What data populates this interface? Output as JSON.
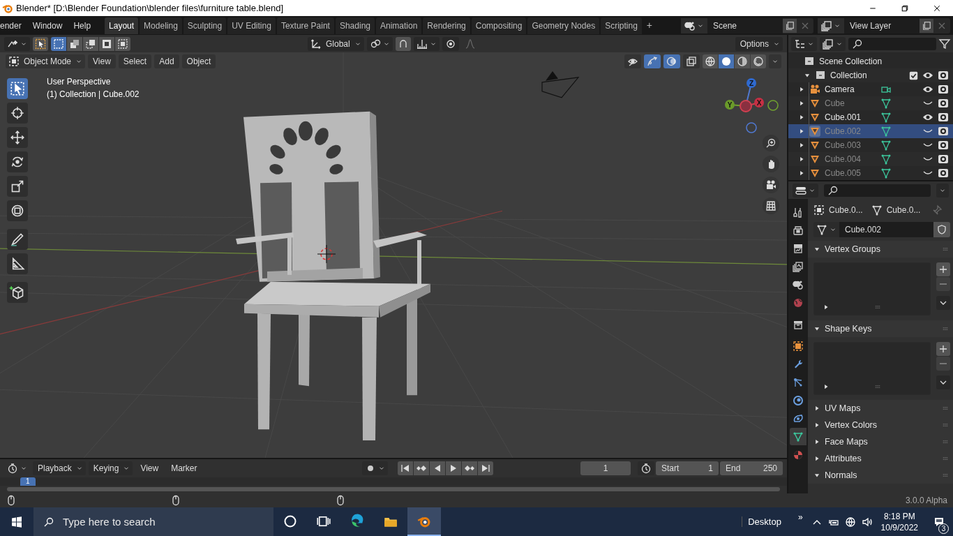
{
  "title_bar": {
    "title": "Blender* [D:\\Blender Foundation\\blender files\\furniture table.blend]"
  },
  "menu": [
    "ender",
    "Window",
    "Help"
  ],
  "workspaces": [
    {
      "label": "Layout",
      "selected": true
    },
    {
      "label": "Modeling",
      "selected": false
    },
    {
      "label": "Sculpting",
      "selected": false
    },
    {
      "label": "UV Editing",
      "selected": false
    },
    {
      "label": "Texture Paint",
      "selected": false
    },
    {
      "label": "Shading",
      "selected": false
    },
    {
      "label": "Animation",
      "selected": false
    },
    {
      "label": "Rendering",
      "selected": false
    },
    {
      "label": "Compositing",
      "selected": false
    },
    {
      "label": "Geometry Nodes",
      "selected": false
    },
    {
      "label": "Scripting",
      "selected": false
    }
  ],
  "add_workspace": "+",
  "scene": "Scene",
  "view_layer": "View Layer",
  "tool_header": {
    "select_modes": [
      {
        "selected": true
      },
      {
        "selected": false
      },
      {
        "selected": false
      },
      {
        "selected": false
      },
      {
        "selected": false
      }
    ],
    "orientation": "Global",
    "options": "Options"
  },
  "view_header": {
    "mode": "Object Mode",
    "menus": [
      "View",
      "Select",
      "Add",
      "Object"
    ],
    "toggles": [
      {
        "kind": "visibility",
        "on": false
      },
      {
        "kind": "gizmo",
        "on": true
      },
      {
        "kind": "overlay",
        "on": true
      },
      {
        "kind": "xray",
        "on": false
      }
    ],
    "shading": [
      {
        "kind": "wireframe",
        "selected": false
      },
      {
        "kind": "solid",
        "selected": true
      },
      {
        "kind": "material",
        "selected": false
      },
      {
        "kind": "rendered",
        "selected": false
      }
    ]
  },
  "toolbar": [
    {
      "kind": "select",
      "selected": true
    },
    {
      "kind": "cursor",
      "selected": false
    },
    {
      "kind": "move",
      "selected": false
    },
    {
      "kind": "rotate",
      "selected": false
    },
    {
      "kind": "scale",
      "selected": false
    },
    {
      "kind": "transform",
      "selected": false
    },
    {
      "kind": "annotate",
      "selected": false
    },
    {
      "kind": "measure",
      "selected": false
    },
    {
      "kind": "add_cube",
      "selected": false
    }
  ],
  "viewport": {
    "perspective": "User Perspective",
    "info": "(1) Collection | Cube.002",
    "gizmo": {
      "x": "X",
      "y": "Y",
      "z": "Z"
    }
  },
  "outliner": {
    "root": {
      "name": "Scene Collection",
      "children": [
        {
          "name": "Collection",
          "expanded": true,
          "checked": true,
          "children": [
            {
              "name": "Camera",
              "kind": "camera",
              "visible": true,
              "selected": false
            },
            {
              "name": "Cube",
              "kind": "mesh",
              "visible": false,
              "selected": false
            },
            {
              "name": "Cube.001",
              "kind": "mesh",
              "visible": true,
              "selected": false
            },
            {
              "name": "Cube.002",
              "kind": "mesh",
              "visible": false,
              "selected": true
            },
            {
              "name": "Cube.003",
              "kind": "mesh",
              "visible": false,
              "selected": false
            },
            {
              "name": "Cube.004",
              "kind": "mesh",
              "visible": false,
              "selected": false
            },
            {
              "name": "Cube.005",
              "kind": "mesh",
              "visible": false,
              "selected": false
            }
          ]
        }
      ]
    }
  },
  "properties": {
    "tabs": [
      {
        "kind": "tool",
        "selected": false
      },
      {
        "kind": "render",
        "selected": false
      },
      {
        "kind": "output",
        "selected": false
      },
      {
        "kind": "view_layer",
        "selected": false
      },
      {
        "kind": "scene",
        "selected": false
      },
      {
        "kind": "world",
        "selected": false
      },
      {
        "kind": "collection",
        "selected": false
      },
      {
        "kind": "object",
        "selected": false
      },
      {
        "kind": "modifiers",
        "selected": false
      },
      {
        "kind": "particles",
        "selected": false
      },
      {
        "kind": "physics",
        "selected": false
      },
      {
        "kind": "constraints",
        "selected": false
      },
      {
        "kind": "data",
        "selected": true
      },
      {
        "kind": "material",
        "selected": false
      }
    ],
    "breadcrumb": [
      "Cube.0...",
      "Cube.0..."
    ],
    "mesh_name": "Cube.002",
    "panels": [
      {
        "title": "Vertex Groups",
        "expanded": true
      },
      {
        "title": "Shape Keys",
        "expanded": true
      },
      {
        "title": "UV Maps",
        "expanded": false
      },
      {
        "title": "Vertex Colors",
        "expanded": false
      },
      {
        "title": "Face Maps",
        "expanded": false
      },
      {
        "title": "Attributes",
        "expanded": false
      },
      {
        "title": "Normals",
        "expanded": true
      }
    ]
  },
  "timeline": {
    "menus": [
      "Playback",
      "Keying",
      "View",
      "Marker"
    ],
    "current_frame": "1",
    "start_label": "Start",
    "start": "1",
    "end_label": "End",
    "end": "250",
    "marker": "1"
  },
  "status_bar": {
    "version": "3.0.0 Alpha"
  },
  "taskbar": {
    "search_placeholder": "Type here to search",
    "apps": [
      {
        "kind": "cortana",
        "selected": false
      },
      {
        "kind": "task_view",
        "selected": false
      },
      {
        "kind": "edge",
        "selected": false
      },
      {
        "kind": "explorer",
        "selected": false
      },
      {
        "kind": "blender",
        "selected": true
      }
    ],
    "desktop": "Desktop",
    "more": "»",
    "time": "8:18 PM",
    "date": "10/9/2022",
    "notifications": "3"
  }
}
